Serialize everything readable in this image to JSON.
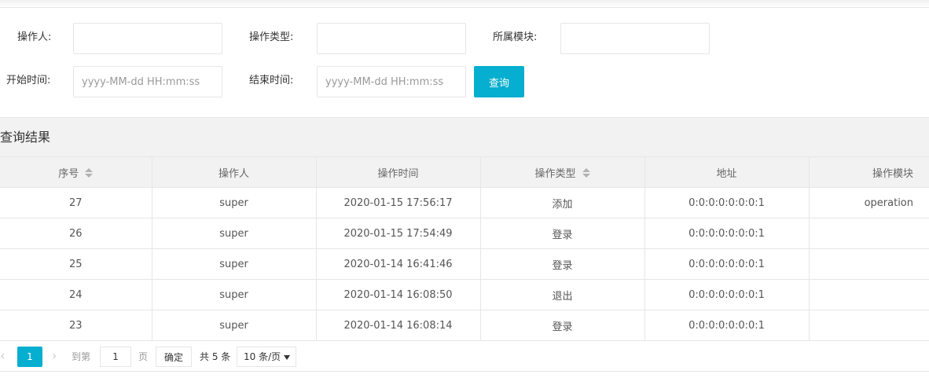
{
  "filters": {
    "operator_label": "操作人:",
    "op_type_label": "操作类型:",
    "module_label": "所属模块:",
    "start_label": "开始时间:",
    "end_label": "结束时间:",
    "operator_value": "",
    "op_type_value": "",
    "module_value": "",
    "start_placeholder": "yyyy-MM-dd HH:mm:ss",
    "end_placeholder": "yyyy-MM-dd HH:mm:ss",
    "query_button": "查询"
  },
  "results": {
    "title": "查询结果",
    "columns": [
      "序号",
      "操作人",
      "操作时间",
      "操作类型",
      "地址",
      "操作模块"
    ],
    "rows": [
      [
        "27",
        "super",
        "2020-01-15 17:56:17",
        "添加",
        "0:0:0:0:0:0:0:1",
        "operation"
      ],
      [
        "26",
        "super",
        "2020-01-15 17:54:49",
        "登录",
        "0:0:0:0:0:0:0:1",
        ""
      ],
      [
        "25",
        "super",
        "2020-01-14 16:41:46",
        "登录",
        "0:0:0:0:0:0:0:1",
        ""
      ],
      [
        "24",
        "super",
        "2020-01-14 16:08:50",
        "退出",
        "0:0:0:0:0:0:0:1",
        ""
      ],
      [
        "23",
        "super",
        "2020-01-14 16:08:14",
        "登录",
        "0:0:0:0:0:0:0:1",
        ""
      ]
    ]
  },
  "pagination": {
    "prev_icon": "chevron-left-icon",
    "next_icon": "chevron-right-icon",
    "prev_glyph": "‹",
    "next_glyph": "›",
    "current_page": "1",
    "goto_label": "到第",
    "goto_value": "1",
    "page_unit": "页",
    "confirm_button": "确定",
    "total_text": "共 5 条",
    "page_size": "10 条/页"
  },
  "colors": {
    "accent": "#06aecf",
    "header_bg": "#f2f2f2",
    "border": "#e6e6e6"
  }
}
